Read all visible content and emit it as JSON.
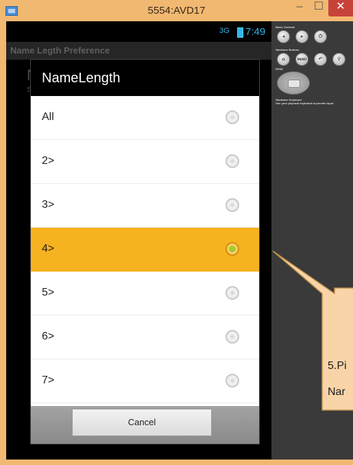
{
  "window": {
    "title": "5554:AVD17",
    "minimize_glyph": "–",
    "maximize_glyph": "☐",
    "close_glyph": "✕"
  },
  "status_bar": {
    "network": "3G",
    "time": "7:49"
  },
  "app": {
    "action_bar_title": "Name Legth Preference",
    "bg_letter": "N",
    "bg_sub": "Se"
  },
  "dialog": {
    "title": "NameLength",
    "options": [
      {
        "label": "All",
        "selected": false
      },
      {
        "label": "2>",
        "selected": false
      },
      {
        "label": "3>",
        "selected": false
      },
      {
        "label": "4>",
        "selected": true
      },
      {
        "label": "5>",
        "selected": false
      },
      {
        "label": "6>",
        "selected": false
      },
      {
        "label": "7>",
        "selected": false
      }
    ],
    "cancel_label": "Cancel"
  },
  "emulator_panel": {
    "basic_controls": "Basic Controls",
    "hardware_buttons": "Hardware Buttons",
    "dpad": "DPAD",
    "hw_keyboard": "Hardware Keyboard",
    "hw_keyboard_hint": "Use your physical keyboard to provide input",
    "menu_label": "MENU"
  },
  "callout": {
    "line1": "5.Pi",
    "line2": "Nar"
  },
  "colors": {
    "selected_row": "#f6b21f",
    "holo_blue": "#33b5e5",
    "callout_fill": "#f9d4a8",
    "callout_border": "#c0904c",
    "radio_selected": "#9ad12a"
  },
  "icons": [
    "window-app-icon",
    "volume-down-icon",
    "volume-up-icon",
    "power-icon",
    "home-icon",
    "back-icon",
    "search-icon",
    "dpad-icon",
    "battery-icon",
    "signal-icon"
  ]
}
